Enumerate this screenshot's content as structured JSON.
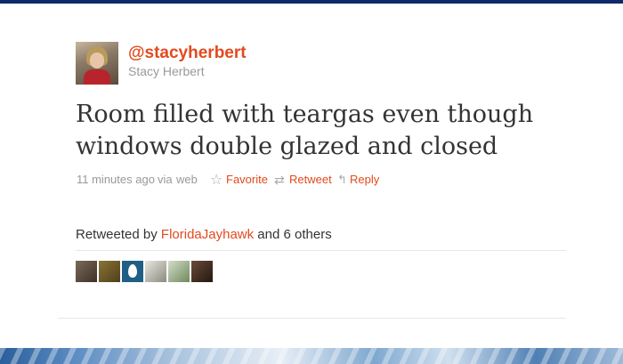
{
  "tweet": {
    "screen_name": "@stacyherbert",
    "full_name": "Stacy Herbert",
    "text": "Room filled with teargas even though windows double glazed and closed"
  },
  "meta": {
    "timestamp": "11 minutes ago",
    "via_label": "via",
    "source": "web",
    "star_icon": "☆",
    "favorite_label": "Favorite",
    "retweet_icon": "⇄",
    "retweet_label": "Retweet",
    "reply_icon": "↰",
    "reply_label": "Reply"
  },
  "retweets": {
    "prefix": "Retweeted by",
    "first_user": "FloridaJayhawk",
    "suffix": "and 6 others",
    "avatars": [
      "retweeter-1",
      "retweeter-2",
      "retweeter-3-default-egg",
      "retweeter-4",
      "retweeter-5",
      "retweeter-6"
    ]
  },
  "colors": {
    "accent": "#e24a1e",
    "top_bar": "#0f2a6b",
    "text": "#333333",
    "muted": "#999999"
  }
}
